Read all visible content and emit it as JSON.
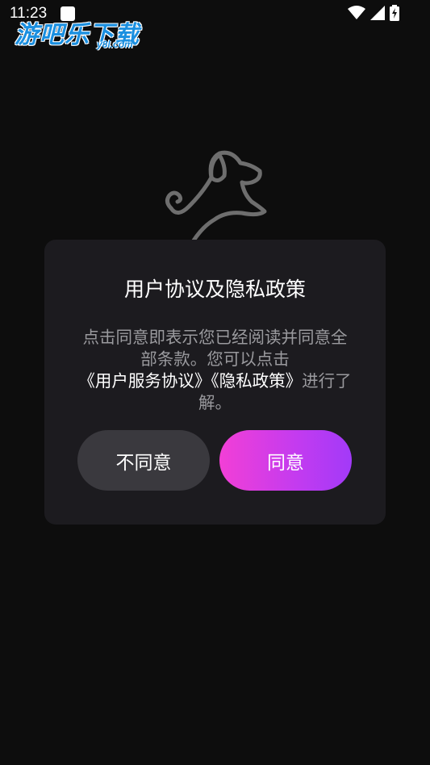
{
  "status_bar": {
    "time": "11:23",
    "icons": [
      "notification-icon",
      "wifi-icon",
      "signal-icon",
      "battery-icon"
    ]
  },
  "watermark": {
    "main": "游吧乐下载",
    "sub": "y8l.com"
  },
  "dialog": {
    "title": "用户协议及隐私政策",
    "body_prefix": "点击同意即表示您已经阅读并同意全部条款。您可以点击",
    "link_user_agreement": "《用户服务协议》",
    "link_privacy_policy": "《隐私政策》",
    "body_suffix": "进行了解。",
    "disagree_label": "不同意",
    "agree_label": "同意"
  },
  "colors": {
    "background": "#0d0d0d",
    "dialog": "#1c1b1f",
    "disagree_button": "#3a393e",
    "agree_gradient_start": "#f23fd6",
    "agree_gradient_end": "#a23af8",
    "body_text": "#9a9a9e",
    "link_text": "#ffffff"
  }
}
